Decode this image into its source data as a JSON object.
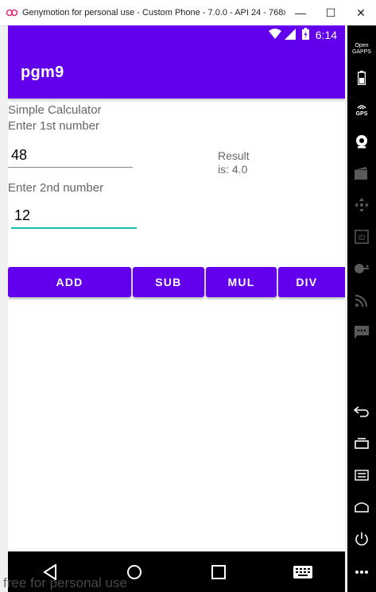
{
  "window": {
    "title": "Genymotion for personal use - Custom Phone - 7.0.0 - API 24 - 768x1...",
    "minimize_glyph": "—",
    "maximize_glyph": "☐",
    "close_glyph": "✕"
  },
  "statusbar": {
    "time": "6:14"
  },
  "appbar": {
    "title": "pgm9"
  },
  "form": {
    "heading": "Simple Calculator",
    "label1": "Enter 1st number",
    "input1_value": "48",
    "label2": "Enter 2nd number",
    "input2_value": "12",
    "result_line1": "Result",
    "result_line2": "is: 4.0"
  },
  "buttons": {
    "add": "ADD",
    "sub": "SUB",
    "mul": "MUL",
    "div": "DIV"
  },
  "sidebar": {
    "gapps_line1": "Open",
    "gapps_line2": "GAPPS",
    "gps_label": "GPS"
  },
  "watermark": "free for personal use",
  "colors": {
    "primary": "#6200ee",
    "accent": "#17c0c0"
  },
  "icons": [
    "genymotion-logo-icon",
    "wifi-icon",
    "signal-icon",
    "battery-icon",
    "back-icon",
    "home-icon",
    "recents-icon",
    "keyboard-icon",
    "battery-widget-icon",
    "gps-icon",
    "camera-icon",
    "video-icon",
    "dpad-icon",
    "id-icon",
    "identity-icon",
    "cast-icon",
    "sms-icon",
    "rotate-icon",
    "overview-icon",
    "menu-icon",
    "home-widget-icon",
    "power-icon",
    "more-icon"
  ]
}
